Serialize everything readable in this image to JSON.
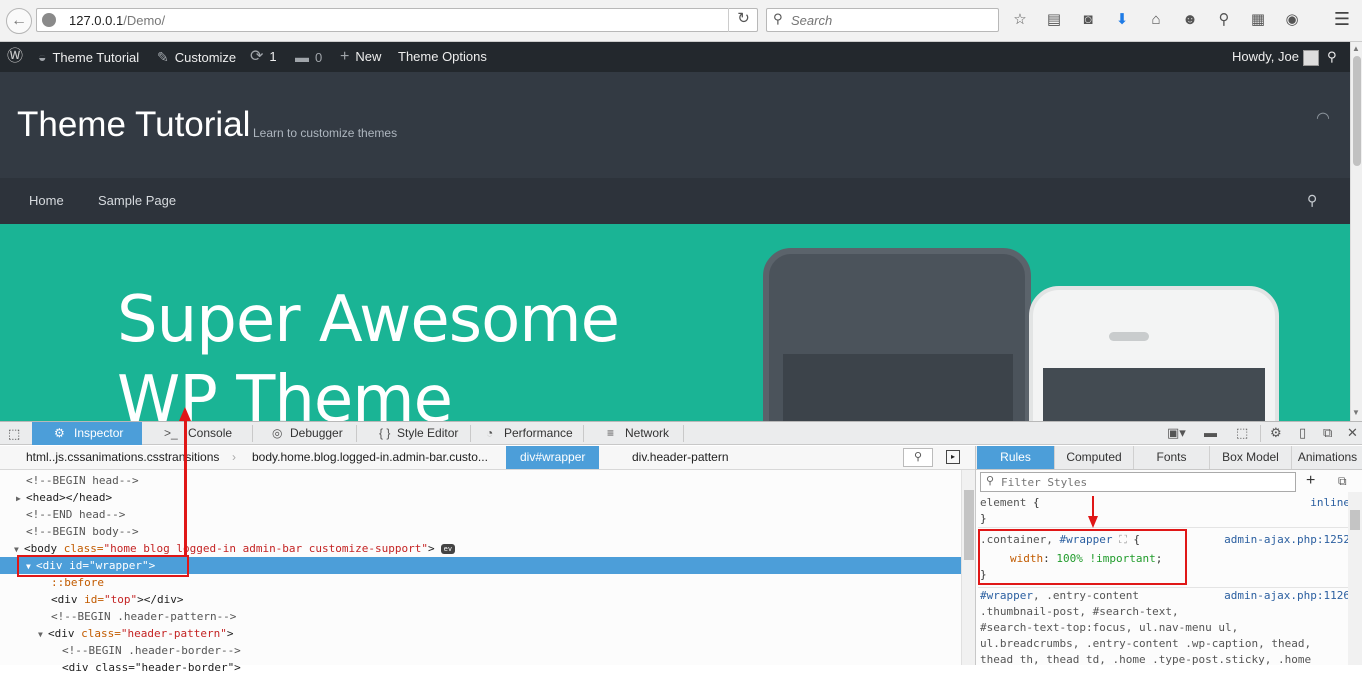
{
  "browser": {
    "url_host": "127.0.0.1",
    "url_path": "/Demo/",
    "search_placeholder": "Search"
  },
  "adminbar": {
    "site_name": "Theme Tutorial",
    "customize": "Customize",
    "updates_count": "1",
    "comments_count": "0",
    "new_label": "New",
    "theme_options": "Theme Options",
    "howdy": "Howdy, Joe"
  },
  "site": {
    "title": "Theme Tutorial",
    "tagline": "Learn to customize themes",
    "nav": [
      "Home",
      "Sample Page"
    ],
    "hero_line1": "Super Awesome",
    "hero_line2": "WP Theme"
  },
  "devtools": {
    "tabs": [
      "Inspector",
      "Console",
      "Debugger",
      "Style Editor",
      "Performance",
      "Network"
    ],
    "breadcrumbs": [
      "html..js.cssanimations.csstransitions",
      "body.home.blog.logged-in.admin-bar.custo...",
      "div#wrapper",
      "div.header-pattern"
    ],
    "markup": {
      "l1": "<!--BEGIN head-->",
      "l2_open": "<head>",
      "l2_close": "</head>",
      "l3": "<!--END head-->",
      "l4": "<!--BEGIN body-->",
      "l5_tag": "<body ",
      "l5_attr": "class=",
      "l5_val": "\"home blog logged-in admin-bar customize-support\"",
      "l5_end": ">",
      "ev": "ev",
      "l6_tag": "<div ",
      "l6_attr": "id=",
      "l6_val": "\"wrapper\"",
      "l6_end": ">",
      "l7": "::before",
      "l8_tag": "<div ",
      "l8_attr": "id=",
      "l8_val": "\"top\"",
      "l8_end": "></div>",
      "l9": "<!--BEGIN .header-pattern-->",
      "l10_tag": "<div ",
      "l10_attr": "class=",
      "l10_val": "\"header-pattern\"",
      "l10_end": ">",
      "l11": "<!--BEGIN .header-border-->",
      "l12": "<div class=\"header-border\">"
    },
    "sidebar_tabs": [
      "Rules",
      "Computed",
      "Fonts",
      "Box Model",
      "Animations"
    ],
    "filter_placeholder": "Filter Styles",
    "rules": {
      "r1_sel": "element",
      "r1_src": "inline",
      "r2_sel_a": ".container, ",
      "r2_sel_b": "#wrapper",
      "r2_src": "admin-ajax.php:1252",
      "r2_prop": "width",
      "r2_val": "100% !important",
      "r3_l1a": "#wrapper",
      "r3_l1b": ", .entry-content",
      "r3_src": "admin-ajax.php:1126",
      "r3_l2": ".thumbnail-post, #search-text,",
      "r3_l3": "#search-text-top:focus, ul.nav-menu ul,",
      "r3_l4": "ul.breadcrumbs, .entry-content .wp-caption, thead,",
      "r3_l5": "thead th, thead td, .home .type-post.sticky, .home"
    }
  },
  "colors": {
    "accent": "#4c9ed9",
    "annotation": "#e01717",
    "hero": "#1ab495",
    "header": "#333a43"
  }
}
